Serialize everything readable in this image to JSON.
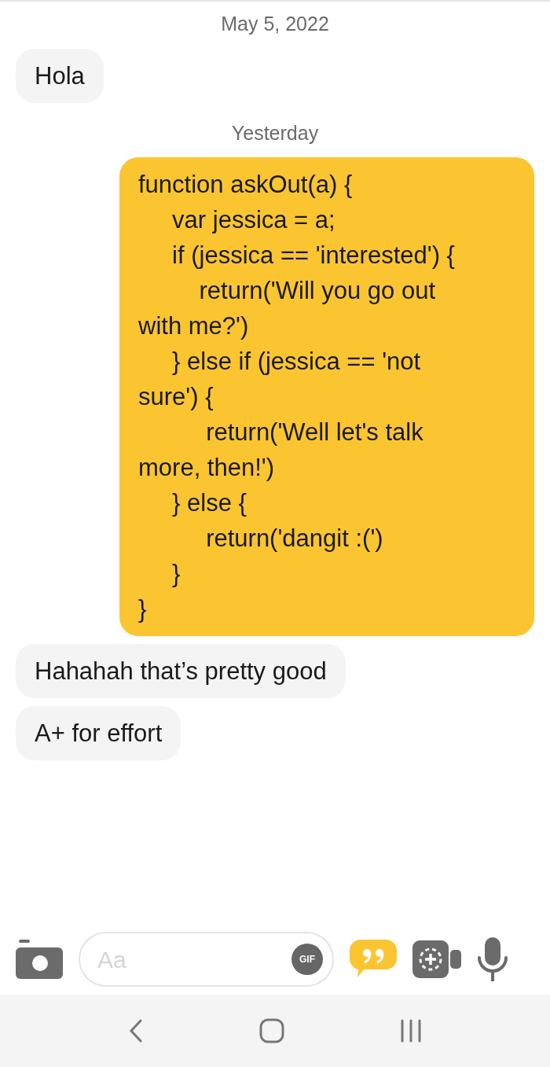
{
  "messages": [
    {
      "kind": "date",
      "text": "May 5, 2022"
    },
    {
      "kind": "message",
      "outgoing": false,
      "text": "Hola"
    },
    {
      "kind": "date",
      "text": "Yesterday"
    },
    {
      "kind": "message",
      "outgoing": true,
      "text": "function askOut(a) {\n     var jessica = a;\n     if (jessica == 'interested') {\n         return('Will you go out\nwith me?')\n     } else if (jessica == 'not\nsure') {\n          return('Well let's talk\nmore, then!')\n     } else {\n          return('dangit :(')\n     }\n}"
    },
    {
      "kind": "message",
      "outgoing": false,
      "text": "Hahahah that’s pretty good"
    },
    {
      "kind": "message",
      "outgoing": false,
      "text": "A+ for effort"
    }
  ],
  "composer": {
    "placeholder": "Aa",
    "gif_label": "GIF"
  }
}
